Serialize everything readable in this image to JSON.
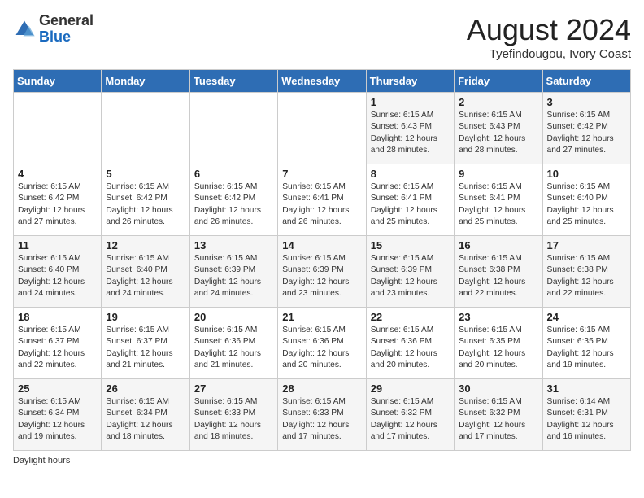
{
  "header": {
    "logo_general": "General",
    "logo_blue": "Blue",
    "month_title": "August 2024",
    "subtitle": "Tyefindougou, Ivory Coast"
  },
  "days_of_week": [
    "Sunday",
    "Monday",
    "Tuesday",
    "Wednesday",
    "Thursday",
    "Friday",
    "Saturday"
  ],
  "weeks": [
    [
      {
        "day": "",
        "info": ""
      },
      {
        "day": "",
        "info": ""
      },
      {
        "day": "",
        "info": ""
      },
      {
        "day": "",
        "info": ""
      },
      {
        "day": "1",
        "info": "Sunrise: 6:15 AM\nSunset: 6:43 PM\nDaylight: 12 hours\nand 28 minutes."
      },
      {
        "day": "2",
        "info": "Sunrise: 6:15 AM\nSunset: 6:43 PM\nDaylight: 12 hours\nand 28 minutes."
      },
      {
        "day": "3",
        "info": "Sunrise: 6:15 AM\nSunset: 6:42 PM\nDaylight: 12 hours\nand 27 minutes."
      }
    ],
    [
      {
        "day": "4",
        "info": "Sunrise: 6:15 AM\nSunset: 6:42 PM\nDaylight: 12 hours\nand 27 minutes."
      },
      {
        "day": "5",
        "info": "Sunrise: 6:15 AM\nSunset: 6:42 PM\nDaylight: 12 hours\nand 26 minutes."
      },
      {
        "day": "6",
        "info": "Sunrise: 6:15 AM\nSunset: 6:42 PM\nDaylight: 12 hours\nand 26 minutes."
      },
      {
        "day": "7",
        "info": "Sunrise: 6:15 AM\nSunset: 6:41 PM\nDaylight: 12 hours\nand 26 minutes."
      },
      {
        "day": "8",
        "info": "Sunrise: 6:15 AM\nSunset: 6:41 PM\nDaylight: 12 hours\nand 25 minutes."
      },
      {
        "day": "9",
        "info": "Sunrise: 6:15 AM\nSunset: 6:41 PM\nDaylight: 12 hours\nand 25 minutes."
      },
      {
        "day": "10",
        "info": "Sunrise: 6:15 AM\nSunset: 6:40 PM\nDaylight: 12 hours\nand 25 minutes."
      }
    ],
    [
      {
        "day": "11",
        "info": "Sunrise: 6:15 AM\nSunset: 6:40 PM\nDaylight: 12 hours\nand 24 minutes."
      },
      {
        "day": "12",
        "info": "Sunrise: 6:15 AM\nSunset: 6:40 PM\nDaylight: 12 hours\nand 24 minutes."
      },
      {
        "day": "13",
        "info": "Sunrise: 6:15 AM\nSunset: 6:39 PM\nDaylight: 12 hours\nand 24 minutes."
      },
      {
        "day": "14",
        "info": "Sunrise: 6:15 AM\nSunset: 6:39 PM\nDaylight: 12 hours\nand 23 minutes."
      },
      {
        "day": "15",
        "info": "Sunrise: 6:15 AM\nSunset: 6:39 PM\nDaylight: 12 hours\nand 23 minutes."
      },
      {
        "day": "16",
        "info": "Sunrise: 6:15 AM\nSunset: 6:38 PM\nDaylight: 12 hours\nand 22 minutes."
      },
      {
        "day": "17",
        "info": "Sunrise: 6:15 AM\nSunset: 6:38 PM\nDaylight: 12 hours\nand 22 minutes."
      }
    ],
    [
      {
        "day": "18",
        "info": "Sunrise: 6:15 AM\nSunset: 6:37 PM\nDaylight: 12 hours\nand 22 minutes."
      },
      {
        "day": "19",
        "info": "Sunrise: 6:15 AM\nSunset: 6:37 PM\nDaylight: 12 hours\nand 21 minutes."
      },
      {
        "day": "20",
        "info": "Sunrise: 6:15 AM\nSunset: 6:36 PM\nDaylight: 12 hours\nand 21 minutes."
      },
      {
        "day": "21",
        "info": "Sunrise: 6:15 AM\nSunset: 6:36 PM\nDaylight: 12 hours\nand 20 minutes."
      },
      {
        "day": "22",
        "info": "Sunrise: 6:15 AM\nSunset: 6:36 PM\nDaylight: 12 hours\nand 20 minutes."
      },
      {
        "day": "23",
        "info": "Sunrise: 6:15 AM\nSunset: 6:35 PM\nDaylight: 12 hours\nand 20 minutes."
      },
      {
        "day": "24",
        "info": "Sunrise: 6:15 AM\nSunset: 6:35 PM\nDaylight: 12 hours\nand 19 minutes."
      }
    ],
    [
      {
        "day": "25",
        "info": "Sunrise: 6:15 AM\nSunset: 6:34 PM\nDaylight: 12 hours\nand 19 minutes."
      },
      {
        "day": "26",
        "info": "Sunrise: 6:15 AM\nSunset: 6:34 PM\nDaylight: 12 hours\nand 18 minutes."
      },
      {
        "day": "27",
        "info": "Sunrise: 6:15 AM\nSunset: 6:33 PM\nDaylight: 12 hours\nand 18 minutes."
      },
      {
        "day": "28",
        "info": "Sunrise: 6:15 AM\nSunset: 6:33 PM\nDaylight: 12 hours\nand 17 minutes."
      },
      {
        "day": "29",
        "info": "Sunrise: 6:15 AM\nSunset: 6:32 PM\nDaylight: 12 hours\nand 17 minutes."
      },
      {
        "day": "30",
        "info": "Sunrise: 6:15 AM\nSunset: 6:32 PM\nDaylight: 12 hours\nand 17 minutes."
      },
      {
        "day": "31",
        "info": "Sunrise: 6:14 AM\nSunset: 6:31 PM\nDaylight: 12 hours\nand 16 minutes."
      }
    ]
  ],
  "footer": {
    "daylight_label": "Daylight hours"
  }
}
